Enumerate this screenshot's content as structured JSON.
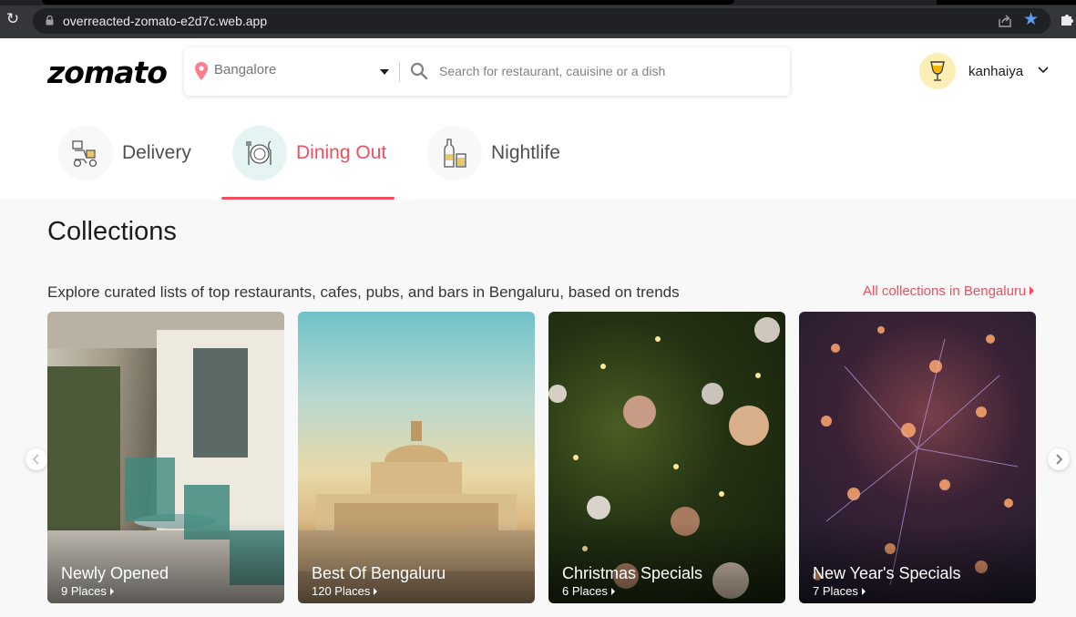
{
  "browser": {
    "url": "overreacted-zomato-e2d7c.web.app"
  },
  "header": {
    "logo": "zomato",
    "location": "Bangalore",
    "search_placeholder": "Search for restaurant, cauisine or a dish",
    "username": "kanhaiya"
  },
  "tabs": [
    {
      "label": "Delivery",
      "icon": "delivery-icon",
      "active": false
    },
    {
      "label": "Dining Out",
      "icon": "dining-out-icon",
      "active": true
    },
    {
      "label": "Nightlife",
      "icon": "nightlife-icon",
      "active": false
    }
  ],
  "collections": {
    "title": "Collections",
    "description": "Explore curated lists of top restaurants, cafes, pubs, and bars in Bengaluru, based on trends",
    "all_link": "All collections in Bengaluru",
    "cards": [
      {
        "title": "Newly Opened",
        "count": "9 Places"
      },
      {
        "title": "Best Of Bengaluru",
        "count": "120 Places"
      },
      {
        "title": "Christmas Specials",
        "count": "6 Places"
      },
      {
        "title": "New Year's Specials",
        "count": "7 Places"
      }
    ]
  },
  "colors": {
    "accent": "#ef4f5f",
    "active_tab_bg": "#e5f3f3",
    "avatar_bg": "#fbefb6",
    "chrome_bg": "#35363a"
  }
}
